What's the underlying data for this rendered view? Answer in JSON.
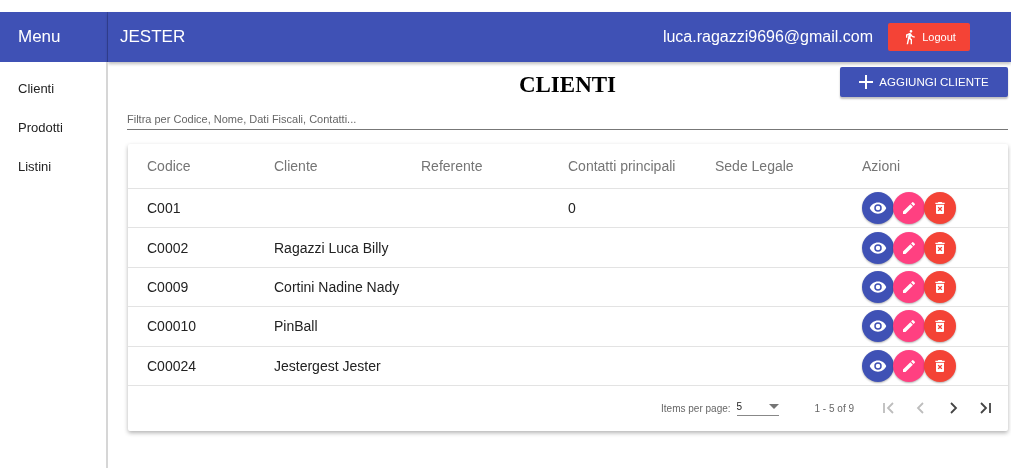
{
  "sidebar": {
    "title": "Menu",
    "items": [
      {
        "label": "Clienti"
      },
      {
        "label": "Prodotti"
      },
      {
        "label": "Listini"
      }
    ]
  },
  "header": {
    "title": "JESTER",
    "user": "luca.ragazzi9696@gmail.com",
    "logout": "Logout"
  },
  "page": {
    "title": "CLIENTI",
    "add_button": "AGGIUNGI CLIENTE",
    "filter": {
      "placeholder": "Filtra per Codice, Nome, Dati Fiscali, Contatti..."
    }
  },
  "table": {
    "columns": [
      "Codice",
      "Cliente",
      "Referente",
      "Contatti principali",
      "Sede Legale",
      "Azioni"
    ],
    "rows": [
      {
        "codice": "C001",
        "contatti": "0"
      },
      {
        "codice": "C0002",
        "cliente": "Ragazzi Luca Billy"
      },
      {
        "codice": "C0009",
        "cliente": "Cortini Nadine Nady"
      },
      {
        "codice": "C00010",
        "cliente": "PinBall"
      },
      {
        "codice": "C00024",
        "cliente": "Jestergest Jester"
      }
    ]
  },
  "paginator": {
    "items_label": "Items per page:",
    "page_size": "5",
    "range": "1 - 5 of 9",
    "buttons": [
      {
        "kind": "first",
        "disabled": true
      },
      {
        "kind": "prev",
        "disabled": true
      },
      {
        "kind": "next",
        "disabled": false
      },
      {
        "kind": "last",
        "disabled": false
      }
    ]
  }
}
